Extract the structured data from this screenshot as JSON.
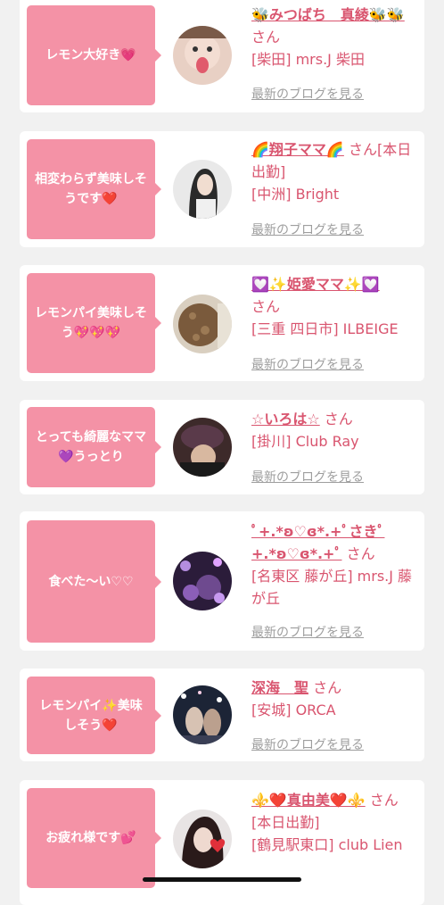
{
  "san": "さん",
  "blog_link": "最新のブログを見る",
  "cards": [
    {
      "comment": "レモン大好き💗",
      "name": "🐝みつばち　真綾🐝🐝",
      "shop": "[柴田] mrs.J 柴田"
    },
    {
      "comment": "相変わらず美味しそうです❤️",
      "name": "🌈翔子ママ🌈",
      "shop": "[中洲] Bright",
      "extra": "[本日出勤]"
    },
    {
      "comment": "レモンパイ美味しそう💖💖💖",
      "name": "💟✨姫愛ママ✨💟",
      "shop": "[三重 四日市] ILBEIGE"
    },
    {
      "comment": "とっても綺麗なママ💜うっとり",
      "name": "☆いろは☆",
      "shop": "[掛川] Club Ray"
    },
    {
      "comment": "食べた〜い♡♡",
      "name": "ﾟ+.*ʚ♡ɞ*.+ﾟさきﾟ+.*ʚ♡ɞ*.+ﾟ",
      "shop": "[名東区 藤が丘] mrs.J 藤が丘"
    },
    {
      "comment": "レモンパイ✨美味しそう❤️",
      "name": "深海　聖",
      "shop": "[安城] ORCA"
    },
    {
      "comment": "お疲れ様です💕",
      "name": "⚜️❤️真由美❤️⚜️",
      "shop": "[鶴見駅東口] club Lien",
      "extra": "[本日出勤]"
    }
  ],
  "colors": {
    "bubble": "#f492a6",
    "name": "#d9556f",
    "link": "#9e9e9e",
    "background": "#f1f1f1"
  }
}
